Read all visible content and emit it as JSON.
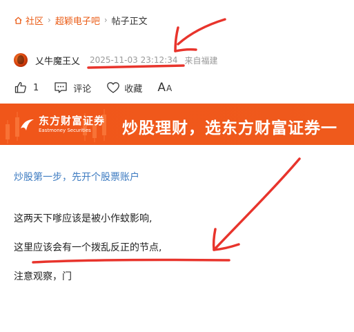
{
  "breadcrumb": {
    "home_label": "社区",
    "bar_label": "超颖电子吧",
    "current_label": "帖子正文"
  },
  "author": {
    "name": "乂牛魔王乂",
    "time": "2025-11-03 23:12:34",
    "location": "来自福建"
  },
  "actions": {
    "like_count": "1",
    "comment_label": "评论",
    "favorite_label": "收藏",
    "font_big": "A",
    "font_small": "A"
  },
  "banner": {
    "brand_cn": "东方财富证券",
    "brand_en": "Eastmoney Securities",
    "slogan": "炒股理财，选东方财富证券一"
  },
  "content": {
    "link_text": "炒股第一步，先开个股票账户",
    "paragraphs": [
      "这两天下嗲应该是被小作蚊影响,",
      "这里应该会有一个拨乱反正的节点,",
      "注意观察，门"
    ]
  },
  "colors": {
    "accent": "#ea5a13",
    "banner_bg": "#f0561a",
    "link": "#3d7bc1",
    "annotation": "#e8342c"
  },
  "icons": [
    "home-icon",
    "thumbs-up-icon",
    "comment-icon",
    "heart-icon",
    "font-size-icon",
    "eastmoney-logo-icon"
  ]
}
